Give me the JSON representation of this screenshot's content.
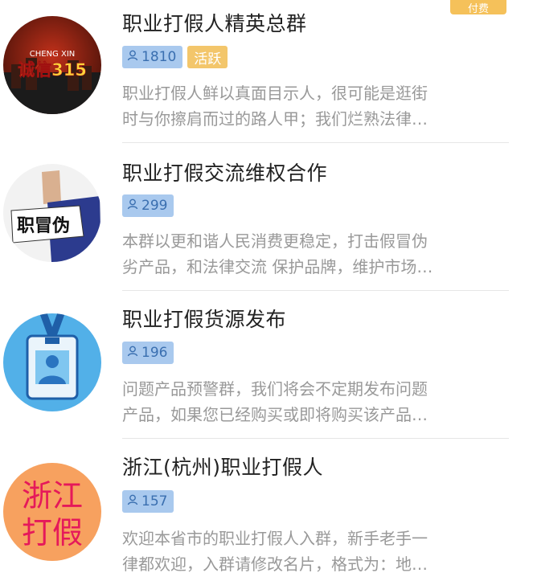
{
  "groups": [
    {
      "title": "职业打假人精英总群",
      "members": "1810",
      "tag": "活跃",
      "paid_tag": "付费",
      "desc": [
        "职业打假人鲜以真面目示人，很可能是逛街",
        "时与你擦肩而过的路人甲；我们烂熟法律…"
      ],
      "avatar": {
        "text_top": "CHENG XIN",
        "text_main": "诚信315"
      }
    },
    {
      "title": "职业打假交流维权合作",
      "members": "299",
      "desc": [
        "本群以更和谐人民消费更稳定，打击假冒伪",
        "劣产品，和法律交流 保护品牌，维护市场…"
      ],
      "avatar": {
        "text_main": "职冒伪"
      }
    },
    {
      "title": "职业打假货源发布",
      "members": "196",
      "desc": [
        "问题产品预警群，我们将会不定期发布问题",
        "产品，如果您已经购买或即将购买该产品…"
      ]
    },
    {
      "title": "浙江(杭州)职业打假人",
      "members": "157",
      "desc": [
        "欢迎本省市的职业打假人入群，新手老手一",
        "律都欢迎，入群请修改名片，格式为：地…"
      ],
      "avatar": {
        "line1": "浙江",
        "line2": "打假"
      }
    }
  ],
  "colors": {
    "badge_blue": "#a9c9ee",
    "badge_orange": "#f3c66b"
  }
}
